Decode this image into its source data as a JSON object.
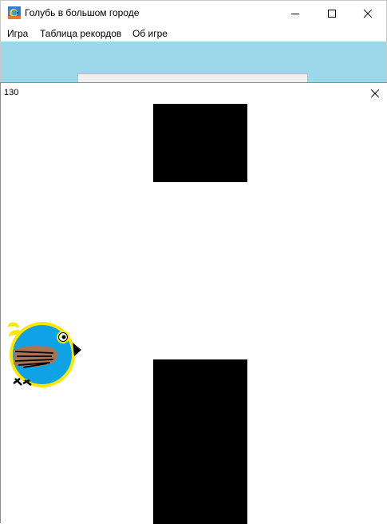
{
  "window": {
    "title": "Голубь в большом городе",
    "icon": "app-icon"
  },
  "menu": {
    "items": [
      "Игра",
      "Таблица рекордов",
      "Об игре"
    ]
  },
  "game": {
    "score": "130",
    "sky_color": "#9bd9ea",
    "pipe_color": "#000000",
    "bird_colors": {
      "body": "#0fa3e6",
      "outline": "#ffe600",
      "wing": "#a87454",
      "beak": "#000000"
    }
  }
}
